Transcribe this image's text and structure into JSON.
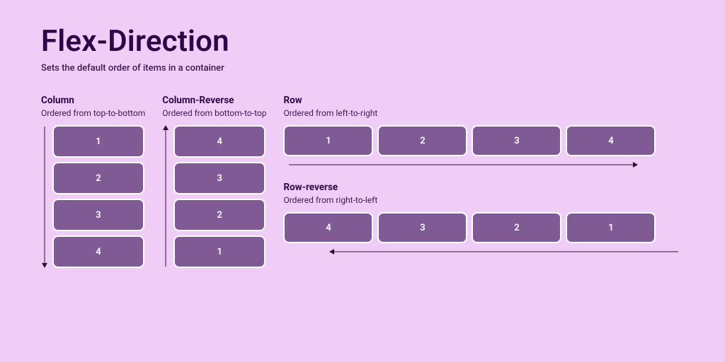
{
  "title": "Flex-Direction",
  "subtitle": "Sets the default order of items in a container",
  "column": {
    "title": "Column",
    "desc": "Ordered from top-to-bottom",
    "items": [
      "1",
      "2",
      "3",
      "4"
    ]
  },
  "column_reverse": {
    "title": "Column-Reverse",
    "desc": "Ordered from bottom-to-top",
    "items": [
      "4",
      "3",
      "2",
      "1"
    ]
  },
  "row": {
    "title": "Row",
    "desc": "Ordered from left-to-right",
    "items": [
      "1",
      "2",
      "3",
      "4"
    ]
  },
  "row_reverse": {
    "title": "Row-reverse",
    "desc": "Ordered from right-to-left",
    "items": [
      "4",
      "3",
      "2",
      "1"
    ]
  }
}
